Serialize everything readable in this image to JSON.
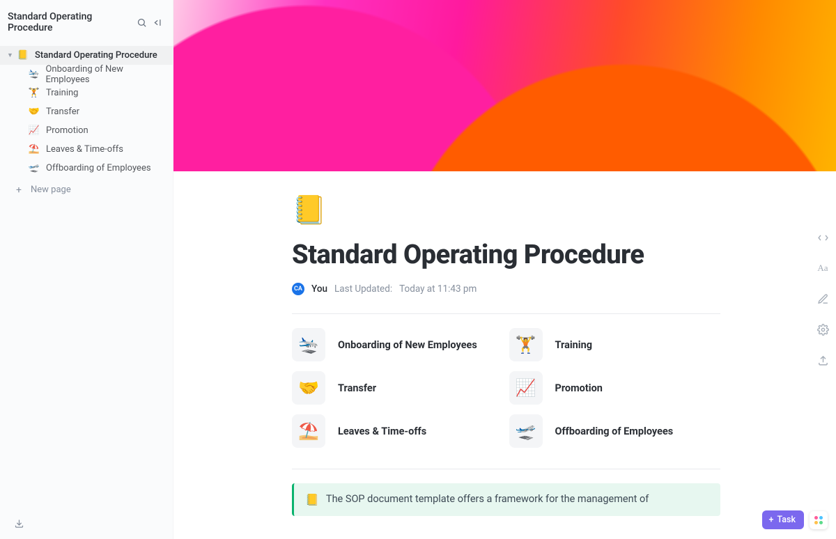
{
  "sidebar": {
    "title": "Standard Operating Procedure",
    "root": {
      "emoji": "📒",
      "label": "Standard Operating Procedure"
    },
    "items": [
      {
        "emoji": "🛬",
        "label": "Onboarding of New Employees"
      },
      {
        "emoji": "🏋️",
        "label": "Training"
      },
      {
        "emoji": "🤝",
        "label": "Transfer"
      },
      {
        "emoji": "📈",
        "label": "Promotion"
      },
      {
        "emoji": "⛱️",
        "label": "Leaves & Time-offs"
      },
      {
        "emoji": "🛫",
        "label": "Offboarding of Employees"
      }
    ],
    "new_page": "New page"
  },
  "page": {
    "emoji": "📒",
    "title": "Standard Operating Procedure",
    "avatar_initials": "CA",
    "author": "You",
    "updated_label": "Last Updated:",
    "updated_value": "Today at 11:43 pm"
  },
  "cards": [
    {
      "emoji": "🛬",
      "label": "Onboarding of New Employees"
    },
    {
      "emoji": "🏋️",
      "label": "Training"
    },
    {
      "emoji": "🤝",
      "label": "Transfer"
    },
    {
      "emoji": "📈",
      "label": "Promotion"
    },
    {
      "emoji": "⛱️",
      "label": "Leaves & Time-offs"
    },
    {
      "emoji": "🛫",
      "label": "Offboarding of Employees"
    }
  ],
  "callout": {
    "emoji": "📒",
    "text": "The SOP document template offers a framework for the management of"
  },
  "footer": {
    "task_button": "Task"
  },
  "colors": {
    "accent": "#7b68ee",
    "callout_bg": "#e7f7f0",
    "callout_border": "#0ab36e"
  }
}
